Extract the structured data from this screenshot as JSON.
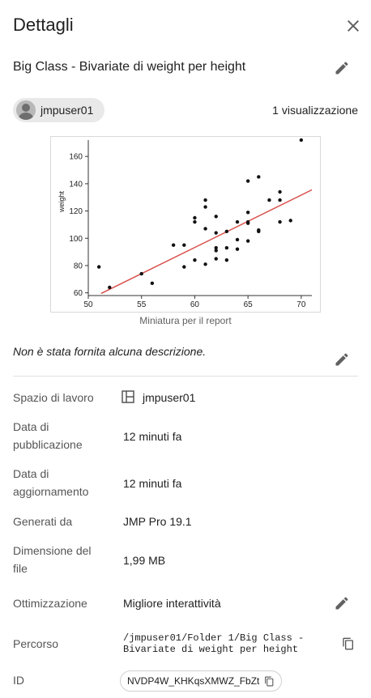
{
  "panel": {
    "title": "Dettagli"
  },
  "report": {
    "title": "Big Class - Bivariate di weight per height"
  },
  "owner": {
    "name": "jmpuser01"
  },
  "views": {
    "text": "1 visualizzazione"
  },
  "thumbnail": {
    "caption": "Miniatura per il report"
  },
  "description": {
    "text": "Non è stata fornita alcuna descrizione."
  },
  "details": {
    "workspace_label": "Spazio di lavoro",
    "workspace_value": "jmpuser01",
    "published_label_1": "Data di",
    "published_label_2": "pubblicazione",
    "published_value": "12 minuti fa",
    "updated_label_1": "Data di",
    "updated_label_2": "aggiornamento",
    "updated_value": "12 minuti fa",
    "generated_label": "Generati da",
    "generated_value": "JMP Pro 19.1",
    "size_label_1": "Dimensione del",
    "size_label_2": "file",
    "size_value": "1,99 MB",
    "optimization_label": "Ottimizzazione",
    "optimization_value": "Migliore interattività",
    "path_label": "Percorso",
    "path_line_1": "/jmpuser01/Folder 1/Big Class -",
    "path_line_2": "Bivariate di weight per height",
    "id_label": "ID",
    "id_value": "NVDP4W_KHKqsXMWZ_FbZt"
  },
  "chart_data": {
    "type": "scatter",
    "ylabel": "weight",
    "xlabel": "",
    "xlim": [
      50,
      71
    ],
    "ylim": [
      58,
      172
    ],
    "x_ticks": [
      50,
      55,
      60,
      65,
      70
    ],
    "y_ticks": [
      60,
      80,
      100,
      120,
      140,
      160
    ],
    "points": [
      [
        51,
        79
      ],
      [
        52,
        64
      ],
      [
        55,
        74
      ],
      [
        56,
        67
      ],
      [
        58,
        95
      ],
      [
        59,
        79
      ],
      [
        59,
        95
      ],
      [
        60,
        84
      ],
      [
        60,
        112
      ],
      [
        60,
        115
      ],
      [
        61,
        81
      ],
      [
        61,
        107
      ],
      [
        61,
        123
      ],
      [
        61,
        128
      ],
      [
        62,
        85
      ],
      [
        62,
        91
      ],
      [
        62,
        93
      ],
      [
        62,
        104
      ],
      [
        62,
        116
      ],
      [
        63,
        84
      ],
      [
        63,
        93
      ],
      [
        63,
        105
      ],
      [
        64,
        92
      ],
      [
        64,
        99
      ],
      [
        64,
        112
      ],
      [
        65,
        98
      ],
      [
        65,
        111
      ],
      [
        65,
        112
      ],
      [
        65,
        119
      ],
      [
        65,
        142
      ],
      [
        66,
        105
      ],
      [
        66,
        106
      ],
      [
        66,
        145
      ],
      [
        67,
        128
      ],
      [
        68,
        112
      ],
      [
        68,
        128
      ],
      [
        68,
        134
      ],
      [
        69,
        113
      ],
      [
        70,
        172
      ]
    ],
    "fit_line": {
      "x": [
        51.2,
        71
      ],
      "y": [
        59.5,
        135.5
      ],
      "color": "#d9534f"
    },
    "point_color": "#111111"
  }
}
